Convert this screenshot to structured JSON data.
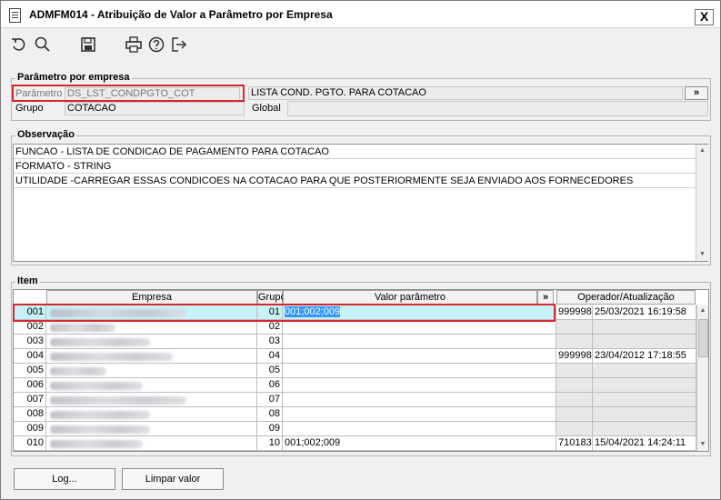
{
  "window": {
    "title": "ADMFM014 - Atribuição de Valor a Parâmetro por Empresa",
    "close_label": "X"
  },
  "toolbar": {
    "icons": [
      "undo-icon",
      "search-icon",
      "save-icon",
      "print-icon",
      "help-icon",
      "exit-icon"
    ]
  },
  "parametro": {
    "legend": "Parâmetro por empresa",
    "parametro_label": "Parâmetro",
    "parametro_value": "DS_LST_CONDPGTO_COT",
    "descricao_value": "LISTA COND. PGTO. PARA COTACAO",
    "lookup_label": "»",
    "grupo_label": "Grupo",
    "grupo_value": "COTACAO",
    "global_label": "Global",
    "global_value": ""
  },
  "observacao": {
    "legend": "Observação",
    "lines": [
      "FUNCAO - LISTA DE CONDICAO DE PAGAMENTO PARA COTACAO",
      "FORMATO - STRING",
      "UTILIDADE -CARREGAR ESSAS CONDICOES NA COTACAO PARA QUE POSTERIORMENTE SEJA ENVIADO AOS FORNECEDORES"
    ]
  },
  "item": {
    "legend": "Item",
    "headers": {
      "empresa": "Empresa",
      "grupo": "Grupo",
      "valor": "Valor parâmetro",
      "expand": "»",
      "operador": "Operador/Atualização"
    },
    "rows": [
      {
        "codigo": "001",
        "grupo": "01",
        "valor": "001;002;009",
        "operador": "999998",
        "data": "25/03/2021 16:19:58"
      },
      {
        "codigo": "002",
        "grupo": "02",
        "valor": "",
        "operador": "",
        "data": ""
      },
      {
        "codigo": "003",
        "grupo": "03",
        "valor": "",
        "operador": "",
        "data": ""
      },
      {
        "codigo": "004",
        "grupo": "04",
        "valor": "",
        "operador": "999998",
        "data": "23/04/2012 17:18:55"
      },
      {
        "codigo": "005",
        "grupo": "05",
        "valor": "",
        "operador": "",
        "data": ""
      },
      {
        "codigo": "006",
        "grupo": "06",
        "valor": "",
        "operador": "",
        "data": ""
      },
      {
        "codigo": "007",
        "grupo": "07",
        "valor": "",
        "operador": "",
        "data": ""
      },
      {
        "codigo": "008",
        "grupo": "08",
        "valor": "",
        "operador": "",
        "data": ""
      },
      {
        "codigo": "009",
        "grupo": "09",
        "valor": "",
        "operador": "",
        "data": ""
      },
      {
        "codigo": "010",
        "grupo": "10",
        "valor": "001;002;009",
        "operador": "710183",
        "data": "15/04/2021 14:24:11"
      }
    ]
  },
  "buttons": {
    "log": "Log...",
    "limpar": "Limpar valor"
  },
  "colors": {
    "highlight_box": "#d9262c",
    "selected_row": "#c7f2f8",
    "selected_value": "#3399ff"
  }
}
